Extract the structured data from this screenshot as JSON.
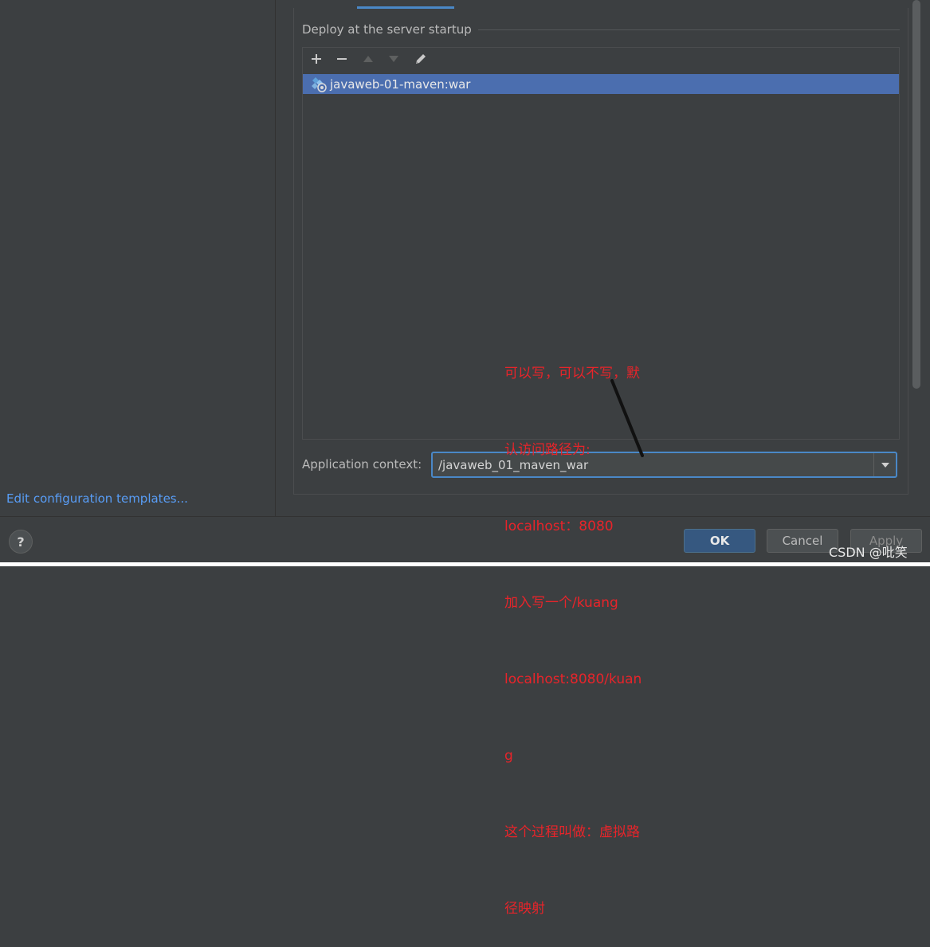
{
  "left_pane": {
    "edit_templates_link": "Edit configuration templates..."
  },
  "deploy": {
    "header": "Deploy at the server startup",
    "toolbar": [
      {
        "icon": "plus-icon",
        "glyph": "+",
        "enabled": true
      },
      {
        "icon": "minus-icon",
        "glyph": "−",
        "enabled": true
      },
      {
        "icon": "move-up-icon",
        "glyph": "▲",
        "enabled": false
      },
      {
        "icon": "move-down-icon",
        "glyph": "▼",
        "enabled": false
      },
      {
        "icon": "edit-pencil-icon",
        "glyph": "✎",
        "enabled": true
      }
    ],
    "artifacts": [
      {
        "label": "javaweb-01-maven:war",
        "icon": "artifact-war-icon",
        "selected": true
      }
    ]
  },
  "app_context": {
    "label": "Application context:",
    "value": "/javaweb_01_maven_war"
  },
  "buttons": {
    "help": "?",
    "ok": "OK",
    "cancel": "Cancel",
    "apply": "Apply"
  },
  "annotation": {
    "lines": [
      "可以写，可以不写，默",
      "认访问路径为:",
      "localhost：8080",
      "加入写一个/kuang",
      "localhost:8080/kuan",
      "g",
      "这个过程叫做：虚拟路",
      "径映射"
    ]
  },
  "watermark": "CSDN @吡笑",
  "colors": {
    "background": "#3c3f41",
    "selection": "#4b6eaf",
    "accent": "#4a88c7",
    "link": "#589df6",
    "annotation": "#e8242a",
    "ok_button": "#365880"
  }
}
